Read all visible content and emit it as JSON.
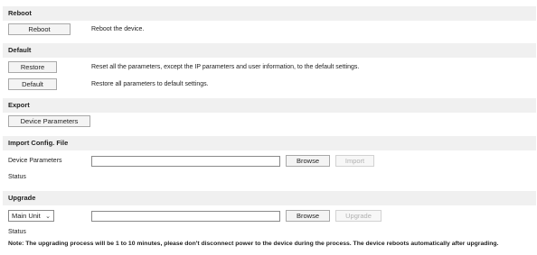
{
  "reboot": {
    "header": "Reboot",
    "button_label": "Reboot",
    "description": "Reboot the device."
  },
  "default": {
    "header": "Default",
    "restore_label": "Restore",
    "restore_description": "Reset all the parameters, except the IP parameters and user information, to the default settings.",
    "default_label": "Default",
    "default_description": "Restore all parameters to default settings."
  },
  "export": {
    "header": "Export",
    "button_label": "Device Parameters"
  },
  "import_config": {
    "header": "Import Config. File",
    "label": "Device Parameters",
    "file_value": "",
    "browse_label": "Browse",
    "import_label": "Import",
    "status_label": "Status"
  },
  "upgrade": {
    "header": "Upgrade",
    "unit_selected": "Main Unit",
    "file_value": "",
    "browse_label": "Browse",
    "upgrade_label": "Upgrade",
    "status_label": "Status",
    "note": "Note: The upgrading process will be 1 to 10 minutes, please don't disconnect power to the device during the process. The device reboots automatically after upgrading."
  },
  "icons": {
    "dropdown": "chevron-down-icon"
  },
  "colors": {
    "section_bg": "#f0f0f0",
    "button_bg": "#f4f4f4",
    "disabled_text": "#b0b0b0"
  }
}
